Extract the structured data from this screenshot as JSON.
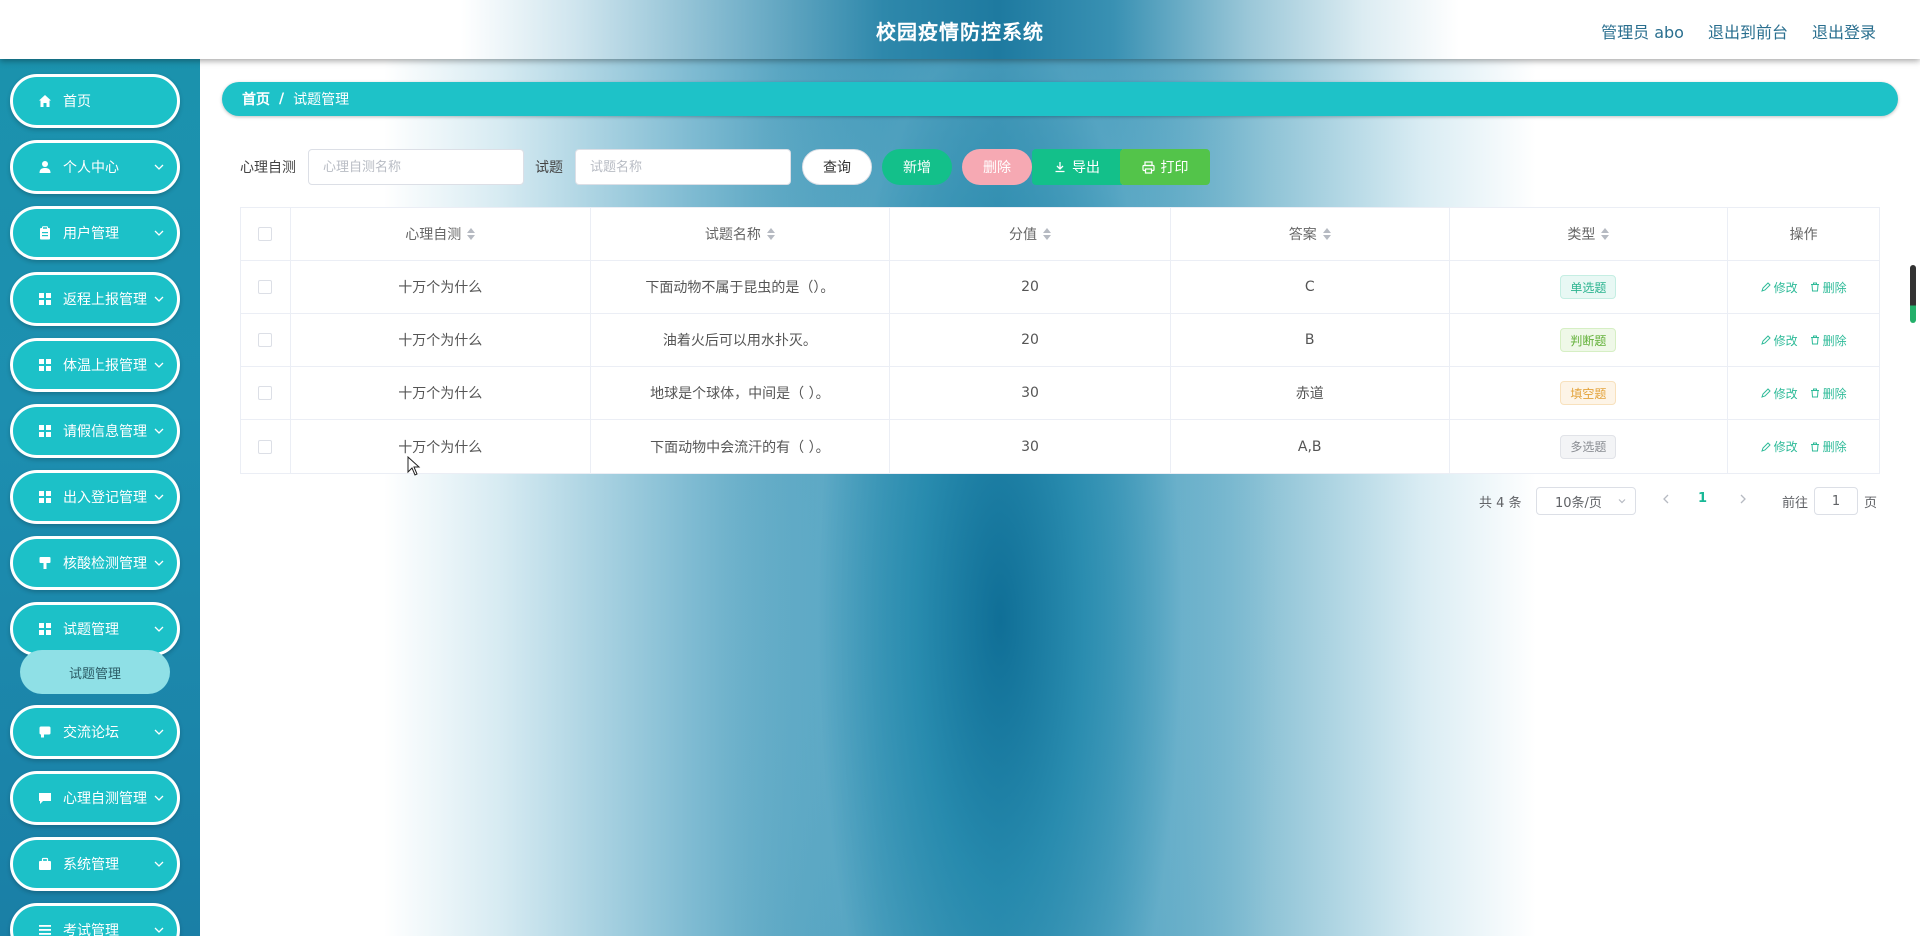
{
  "header": {
    "title": "校园疫情防控系统",
    "user": "管理员 abo",
    "to_front": "退出到前台",
    "logout": "退出登录"
  },
  "sidebar": {
    "items": [
      {
        "label": "首页",
        "icon": "home-icon"
      },
      {
        "label": "个人中心",
        "icon": "user-icon"
      },
      {
        "label": "用户管理",
        "icon": "clipboard-icon"
      },
      {
        "label": "返程上报管理",
        "icon": "grid-icon"
      },
      {
        "label": "体温上报管理",
        "icon": "grid-icon"
      },
      {
        "label": "请假信息管理",
        "icon": "grid-icon"
      },
      {
        "label": "出入登记管理",
        "icon": "grid-icon"
      },
      {
        "label": "核酸检测管理",
        "icon": "brush-icon"
      },
      {
        "label": "试题管理",
        "icon": "grid-icon"
      },
      {
        "label": "交流论坛",
        "icon": "chat-icon"
      },
      {
        "label": "心理自测管理",
        "icon": "comment-icon"
      },
      {
        "label": "系统管理",
        "icon": "briefcase-icon"
      },
      {
        "label": "考试管理",
        "icon": "list-icon"
      }
    ],
    "submenu": {
      "label": "试题管理"
    }
  },
  "breadcrumb": {
    "home": "首页",
    "separator": "/",
    "current": "试题管理"
  },
  "search": {
    "label1": "心理自测",
    "placeholder1": "心理自测名称",
    "label2": "试题",
    "placeholder2": "试题名称",
    "query": "查询",
    "add": "新增",
    "delete": "删除",
    "export": "导出",
    "print": "打印"
  },
  "table": {
    "headers": [
      "心理自测",
      "试题名称",
      "分值",
      "答案",
      "类型",
      "操作"
    ],
    "rows": [
      {
        "test": "十万个为什么",
        "name": "下面动物不属于昆虫的是（）。",
        "score": "20",
        "answer": "C",
        "type": "单选题"
      },
      {
        "test": "十万个为什么",
        "name": "油着火后可以用水扑灭。",
        "score": "20",
        "answer": "B",
        "type": "判断题"
      },
      {
        "test": "十万个为什么",
        "name": "地球是个球体，中间是（ ）。",
        "score": "30",
        "answer": "赤道",
        "type": "填空题"
      },
      {
        "test": "十万个为什么",
        "name": "下面动物中会流汗的有（ ）。",
        "score": "30",
        "answer": "A,B",
        "type": "多选题"
      }
    ],
    "edit": "修改",
    "remove": "删除"
  },
  "pagination": {
    "total": "共 4 条",
    "page_size": "10条/页",
    "current_page": "1",
    "goto": "前往",
    "goto_value": "1",
    "page_unit": "页"
  },
  "colors": {
    "accent": "#1ec2c8",
    "green": "#13c08a",
    "sidebar": "#1b92ad"
  }
}
